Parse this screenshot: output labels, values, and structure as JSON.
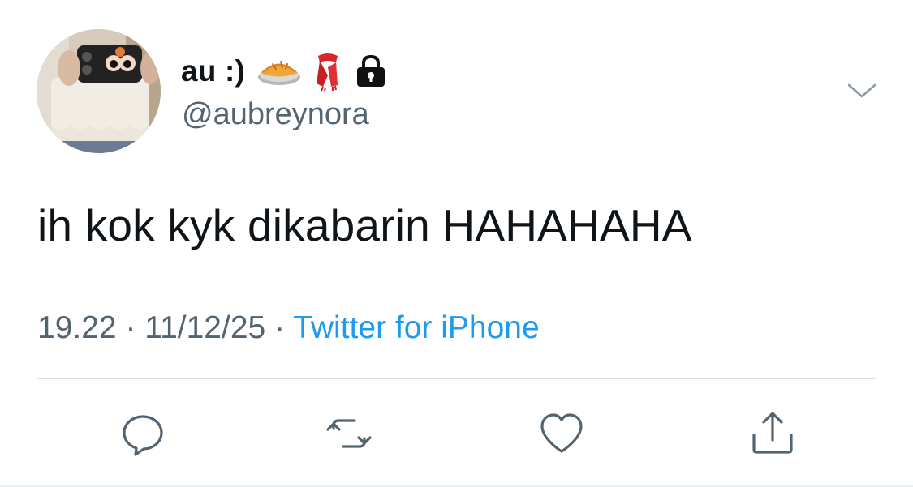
{
  "user": {
    "display_name": "au :)",
    "handle": "@aubreynora",
    "name_emojis": [
      "pie-emoji",
      "scarf-emoji",
      "lock-icon"
    ]
  },
  "tweet": {
    "text": "ih kok kyk dikabarin HAHAHAHA",
    "time": "19.22",
    "date": "11/12/25",
    "separator": "·",
    "source": "Twitter for iPhone"
  },
  "actions": [
    "reply-icon",
    "retweet-icon",
    "like-icon",
    "share-icon"
  ],
  "colors": {
    "text": "#0f1419",
    "secondary": "#536471",
    "link": "#1d9bf0",
    "divider": "#d9dee2"
  }
}
